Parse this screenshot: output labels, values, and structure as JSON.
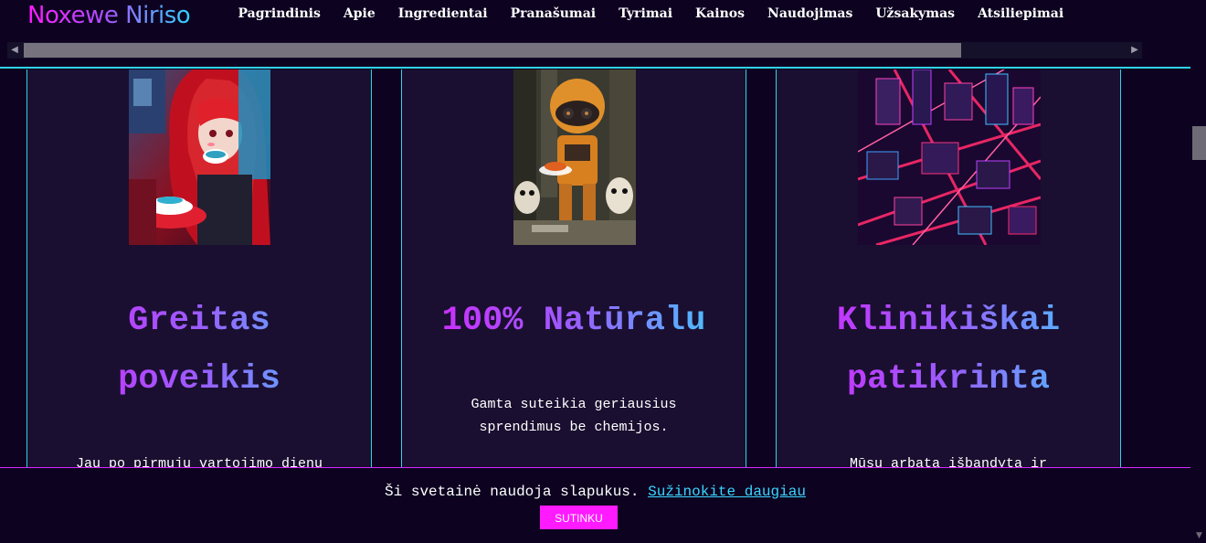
{
  "header": {
    "logo": "Noxewe Niriso",
    "nav": [
      "Pagrindinis",
      "Apie",
      "Ingredientai",
      "Pranašumai",
      "Tyrimai",
      "Kainos",
      "Naudojimas",
      "Užsakymas",
      "Atsiliepimai"
    ]
  },
  "icons": {
    "scroll_left": "chevron-left-icon",
    "scroll_right": "chevron-right-icon",
    "scroll_down": "chevron-down-icon"
  },
  "cards": [
    {
      "title_line1": "Greitas",
      "title_line2": "poveikis",
      "text": "Jau po pirmųjų vartojimo dienų"
    },
    {
      "title_line1": "100% Natūralu",
      "text_line1": "Gamta suteikia geriausius",
      "text_line2": "sprendimus be chemijos."
    },
    {
      "title_line1": "Klinikiškai",
      "title_line2": "patikrinta",
      "text": "Mūsų arbata išbandyta ir"
    }
  ],
  "cookie": {
    "message": "Ši svetainė naudoja slapukus.",
    "link": "Sužinokite daugiau",
    "button": "SUTINKU"
  },
  "colors": {
    "accent_cyan": "#2fd3e6",
    "accent_magenta": "#ff1aff",
    "background": "#0d0320",
    "card_bg": "#1a0f30"
  }
}
